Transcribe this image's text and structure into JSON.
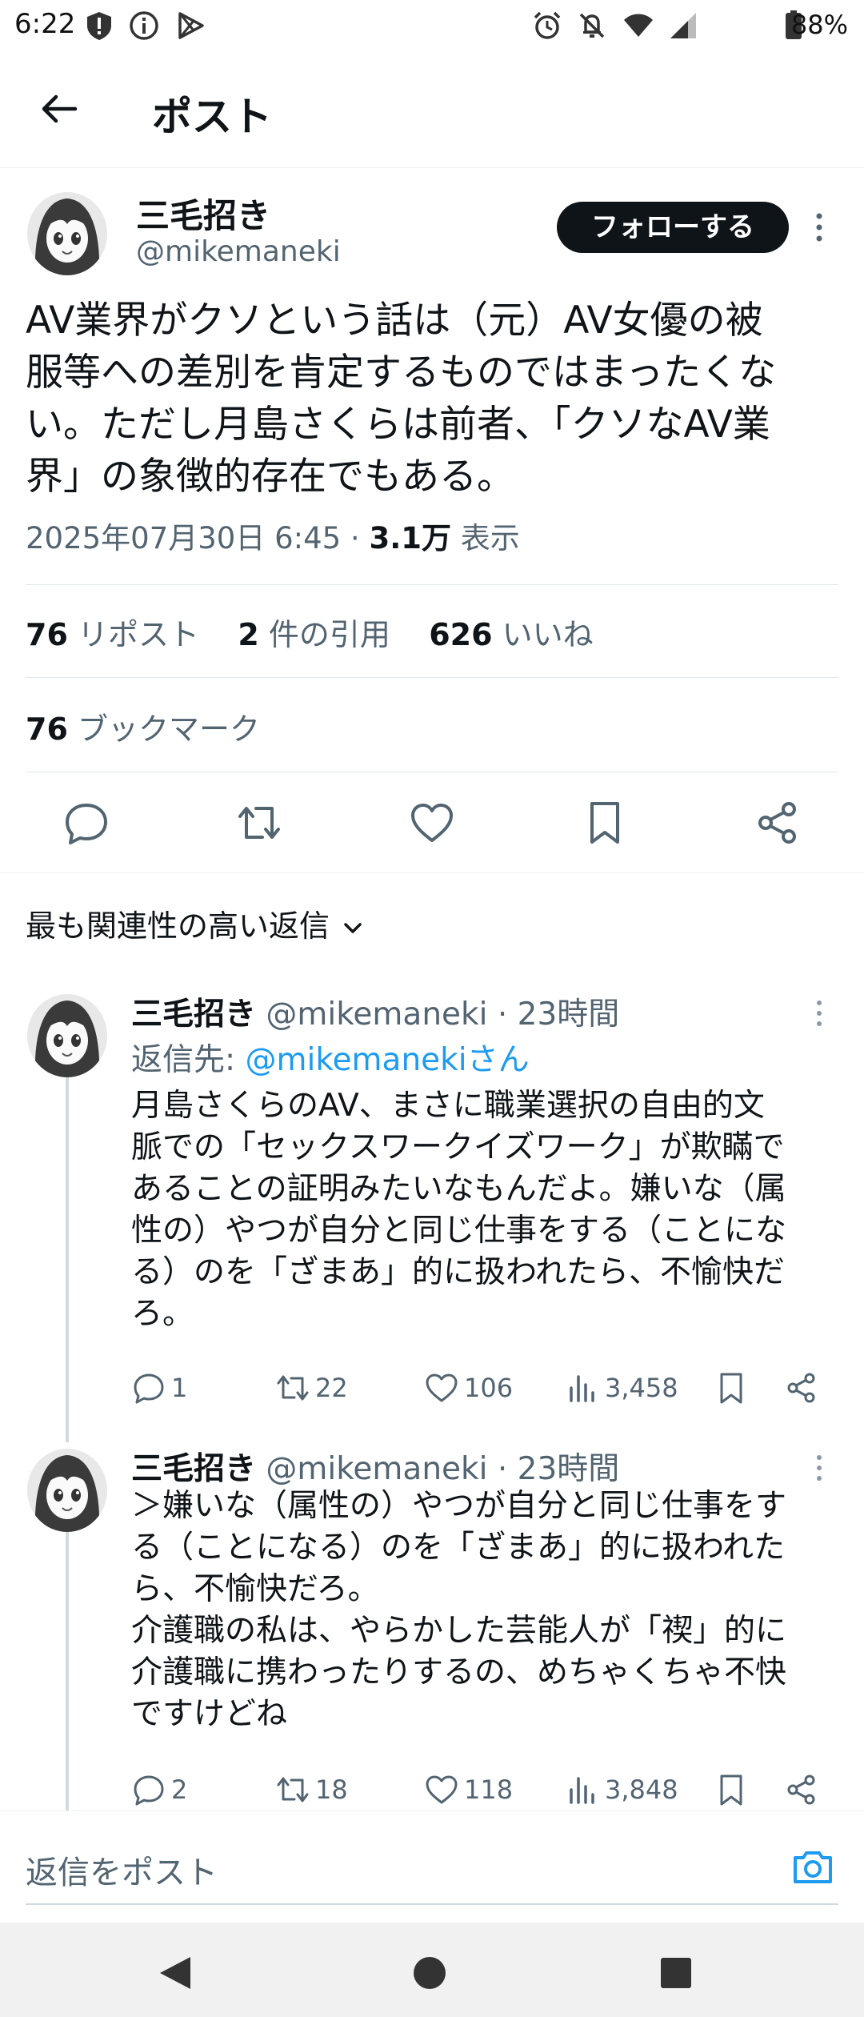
{
  "status_bar": {
    "time": "6:22",
    "battery": "88%"
  },
  "header": {
    "title": "ポスト"
  },
  "tweet": {
    "name": "三毛招き",
    "handle": "@mikemaneki",
    "follow_label": "フォローする",
    "text_lines": [
      "AV業界がクソという話は（元）AV女優の被",
      "服等への差別を肯定するものではまったくな",
      "い。ただし月島さくらは前者、「クソなAV業",
      "界」の象徴的存在でもある。"
    ],
    "timestamp": "2025年07月30日 6:45 · ",
    "views_count": "3.1万",
    "views_label": " 表示",
    "reposts_count": "76",
    "reposts_label": " リポスト",
    "quotes_count": "2",
    "quotes_label": " 件の引用",
    "likes_count": "626",
    "likes_label": " いいね",
    "bookmarks_count": "76",
    "bookmarks_label": " ブックマーク"
  },
  "sort_label": "最も関連性の高い返信",
  "replies": [
    {
      "name": "三毛招き",
      "handle_time": " @mikemaneki · 23時間",
      "reply_to_prefix": "返信先: ",
      "reply_to_user": "@mikemanekiさん",
      "text_lines": [
        "月島さくらのAV、まさに職業選択の自由的文",
        "脈での「セックスワークイズワーク」が欺瞞で",
        "あることの証明みたいなもんだよ。嫌いな（属",
        "性の）やつが自分と同じ仕事をする（ことにな",
        "る）のを「ざまあ」的に扱われたら、不愉快だ",
        "ろ。"
      ],
      "replies": "1",
      "reposts": "22",
      "likes": "106",
      "views": "3,458"
    },
    {
      "name": "三毛招き",
      "handle_time": " @mikemaneki · 23時間",
      "text_lines": [
        "＞嫌いな（属性の）やつが自分と同じ仕事をす",
        "る（ことになる）のを「ざまあ」的に扱われた",
        "ら、不愉快だろ。",
        "介護職の私は、やらかした芸能人が「禊」的に",
        "介護職に携わったりするの、めちゃくちゃ不快",
        "ですけどね"
      ],
      "replies": "2",
      "reposts": "18",
      "likes": "118",
      "views": "3,848"
    }
  ],
  "compose": {
    "placeholder": "返信をポスト"
  }
}
